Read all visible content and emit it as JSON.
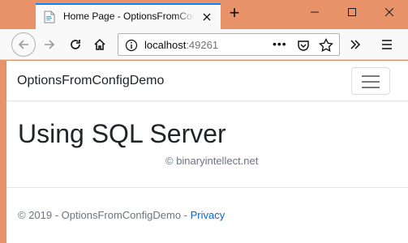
{
  "browser": {
    "tab": {
      "title": "Home Page - OptionsFromConfigDemo",
      "favicon": "page-icon"
    },
    "new_tab_label": "+",
    "url": {
      "host": "localhost",
      "port": ":49261"
    },
    "icons": [
      "back-icon",
      "forward-icon",
      "reload-icon",
      "home-icon",
      "info-icon",
      "more-dots-icon",
      "pocket-icon",
      "star-icon",
      "overflow-chevron-icon",
      "hamburger-menu-icon",
      "minimize-icon",
      "maximize-icon",
      "close-icon"
    ],
    "more_dots": "•••"
  },
  "page": {
    "brand": "OptionsFromConfigDemo",
    "heading": "Using SQL Server",
    "subtext": "© binaryintellect.net",
    "footer": {
      "text": "© 2019 - OptionsFromConfigDemo - ",
      "privacy_link": "Privacy"
    }
  },
  "colors": {
    "window_frame": "#e8926a",
    "link": "#0366d6",
    "tab_highlight": "#0a84ff"
  }
}
